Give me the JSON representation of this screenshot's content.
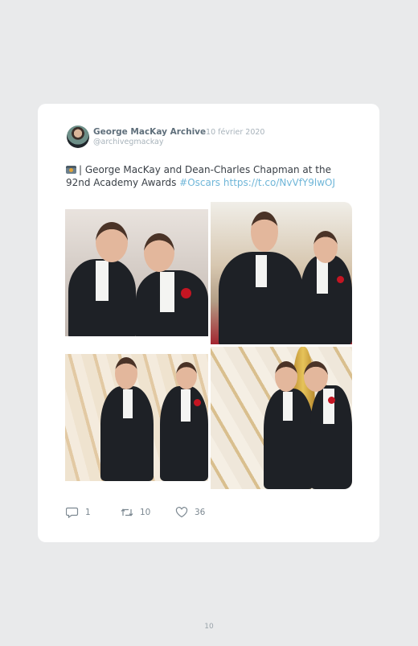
{
  "tweet": {
    "author_name": "George MacKay Archive",
    "date": "· 10 février 2020",
    "handle": "@archivegmackay",
    "text_main": "| George MacKay and Dean-Charles Chapman at the 92nd Academy Awards ",
    "hashtag": "#Oscars",
    "link": "https://t.co/NvVfY9lwOJ"
  },
  "actions": {
    "replies": "1",
    "retweets": "10",
    "likes": "36"
  },
  "icons": {
    "text_emoji": "camera-icon",
    "reply": "speech-bubble-icon",
    "retweet": "retweet-icon",
    "like": "heart-icon"
  },
  "colors": {
    "background": "#e9eaeb",
    "card": "#ffffff",
    "name": "#5f6f7b",
    "meta": "#a8b3bb",
    "link": "#6fb6d8",
    "body_text": "#3a4047"
  },
  "page": {
    "number": "10"
  }
}
